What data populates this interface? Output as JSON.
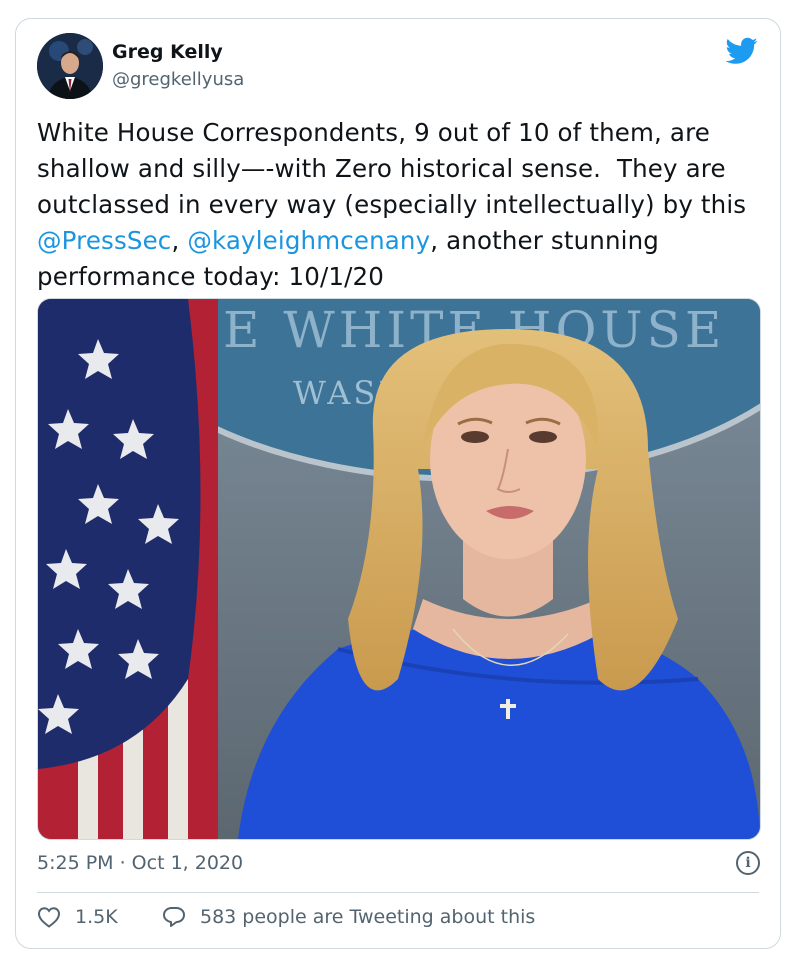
{
  "tweet": {
    "author_name": "Greg Kelly",
    "author_handle": "@gregkellyusa",
    "text_1": "White House Correspondents, 9 out of 10 of them, are shallow and silly—-with Zero historical sense.  They are outclassed in every way (especially intellectually) by this  ",
    "mention_1": "@PressSec",
    "text_2": ", ",
    "mention_2": "@kayleighmcenany",
    "text_3": ", another stunning performance today: 10/1/20",
    "timestamp": "5:25 PM · Oct 1, 2020",
    "likes_count": "1.5K",
    "tweeting_text": "583 people are Tweeting about this"
  },
  "media": {
    "sign_line_1": "THE WHITE HOUSE",
    "sign_line_2": "WASH"
  },
  "icons": {
    "brand": "twitter-bird-icon",
    "info": "info-icon",
    "like": "heart-icon",
    "reply": "speech-bubble-icon"
  },
  "colors": {
    "mention": "#1b95e0",
    "brand": "#1d9bf0",
    "secondary_text": "#536471",
    "border": "#cfd9de"
  }
}
